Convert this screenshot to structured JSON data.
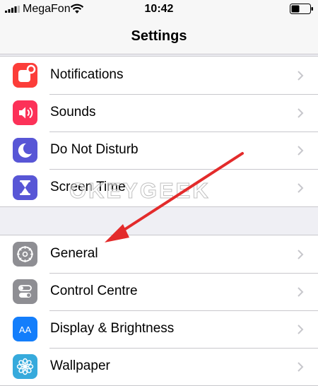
{
  "status_bar": {
    "carrier": "MegaFon",
    "time": "10:42"
  },
  "nav": {
    "title": "Settings"
  },
  "groups": [
    {
      "items": [
        {
          "label": "Notifications",
          "icon": "notifications-icon",
          "color": "#fc3d39"
        },
        {
          "label": "Sounds",
          "icon": "sounds-icon",
          "color": "#fc3158"
        },
        {
          "label": "Do Not Disturb",
          "icon": "moon-icon",
          "color": "#5856d6"
        },
        {
          "label": "Screen Time",
          "icon": "hourglass-icon",
          "color": "#5856d6"
        }
      ]
    },
    {
      "items": [
        {
          "label": "General",
          "icon": "gear-icon",
          "color": "#8e8e93"
        },
        {
          "label": "Control Centre",
          "icon": "switches-icon",
          "color": "#8e8e93"
        },
        {
          "label": "Display & Brightness",
          "icon": "text-size-icon",
          "color": "#147efb"
        },
        {
          "label": "Wallpaper",
          "icon": "flower-icon",
          "color": "#36aadc"
        }
      ]
    }
  ],
  "watermark": "OKEYGEEK",
  "annotation_color": "#e32b2b"
}
